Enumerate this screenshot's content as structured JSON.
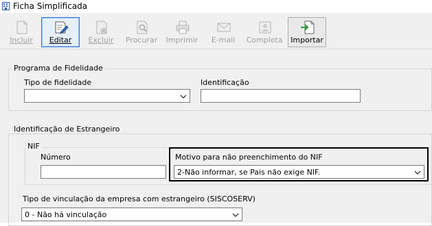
{
  "window": {
    "title": "Ficha Simplificada"
  },
  "toolbar": {
    "buttons": [
      {
        "label": "Incluir",
        "icon": "document-new-icon",
        "enabled": false
      },
      {
        "label": "Editar",
        "icon": "edit-pencil-icon",
        "enabled": true,
        "active": true
      },
      {
        "label": "Excluir",
        "icon": "delete-document-icon",
        "enabled": false
      },
      {
        "label": "Procurar",
        "icon": "search-document-icon",
        "enabled": false
      },
      {
        "label": "Imprimir",
        "icon": "printer-icon",
        "enabled": false
      },
      {
        "label": "E-mail",
        "icon": "envelope-icon",
        "enabled": false
      },
      {
        "label": "Completa",
        "icon": "contact-card-icon",
        "enabled": false
      },
      {
        "label": "Importar",
        "icon": "import-document-icon",
        "enabled": true
      }
    ]
  },
  "fidelidade": {
    "group_title": "Programa de Fidelidade",
    "tipo_label": "Tipo de fidelidade",
    "tipo_value": "",
    "identificacao_label": "Identificação",
    "identificacao_value": ""
  },
  "estrangeiro": {
    "group_title": "Identificação de Estrangeiro",
    "nif_title": "NIF",
    "numero_label": "Número",
    "numero_value": "",
    "motivo_label": "Motivo para não preenchimento do NIF",
    "motivo_value": "2-Não informar, se Pais não exige NIF.",
    "vinculacao_label": "Tipo de vinculação da empresa com estrangeiro (SISCOSERV)",
    "vinculacao_value": "0 - Não há vinculação"
  },
  "colors": {
    "active_border": "#3a7bd5",
    "disabled_text": "#a0a0a0",
    "highlight": "#000000"
  }
}
